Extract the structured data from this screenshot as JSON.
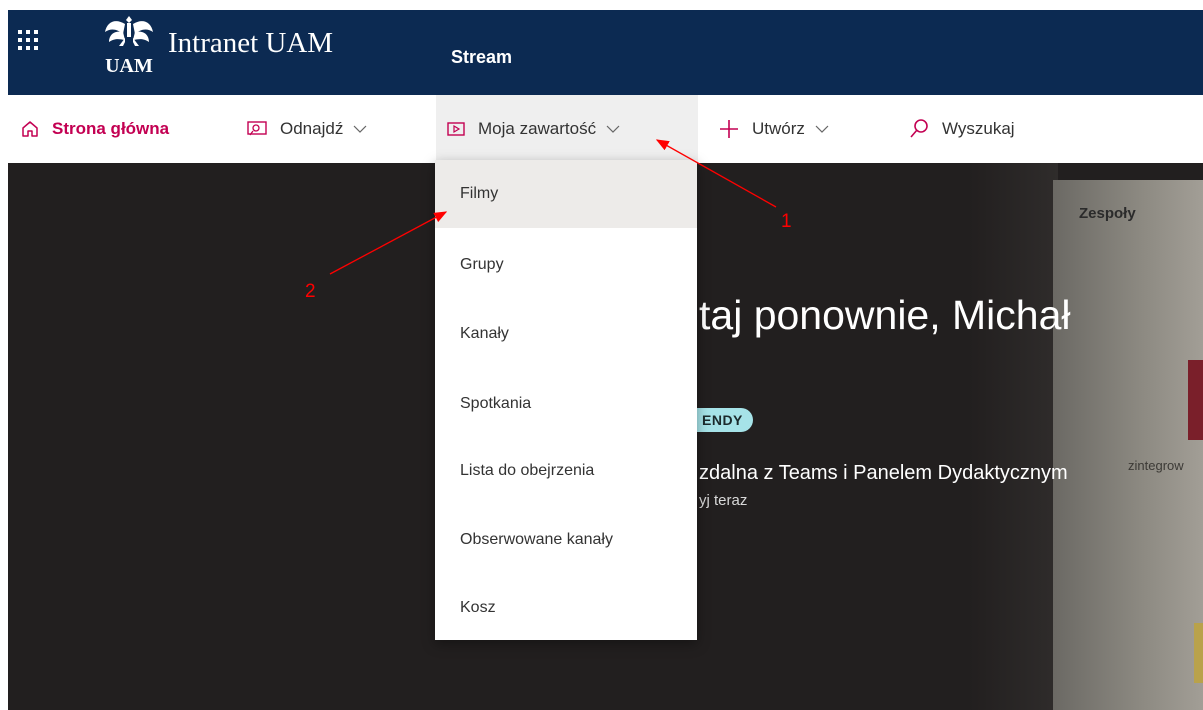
{
  "topbar": {
    "logo_text": "Intranet UAM",
    "logo_icon": "uam-eagle-emblem-icon",
    "app_name": "Stream",
    "waffle_icon": "app-launcher-waffle-icon"
  },
  "nav": {
    "items": [
      {
        "label": "Strona główna",
        "icon": "home-icon"
      },
      {
        "label": "Odnajdź",
        "icon": "discover-icon"
      },
      {
        "label": "Moja zawartość",
        "icon": "video-icon"
      },
      {
        "label": "Utwórz",
        "icon": "plus-icon"
      },
      {
        "label": "Wyszukaj",
        "icon": "search-icon"
      }
    ]
  },
  "menu": {
    "items": [
      "Filmy",
      "Grupy",
      "Kanały",
      "Spotkania",
      "Lista do obejrzenia",
      "Obserwowane kanały",
      "Kosz"
    ]
  },
  "hero": {
    "title": "taj ponownie, Michał",
    "badge": "ENDY",
    "video_title": "zdalna z Teams i Panelem Dydaktycznym",
    "video_subtitle": "yj teraz",
    "card_label": "Zespoły",
    "side_text": "zintegrow"
  },
  "annotations": {
    "labels": [
      "1",
      "2"
    ],
    "color": "#ff0000"
  },
  "colors": {
    "topbar": "#0c2a52",
    "accent": "#c30052",
    "hero_bg": "#221f1f"
  }
}
